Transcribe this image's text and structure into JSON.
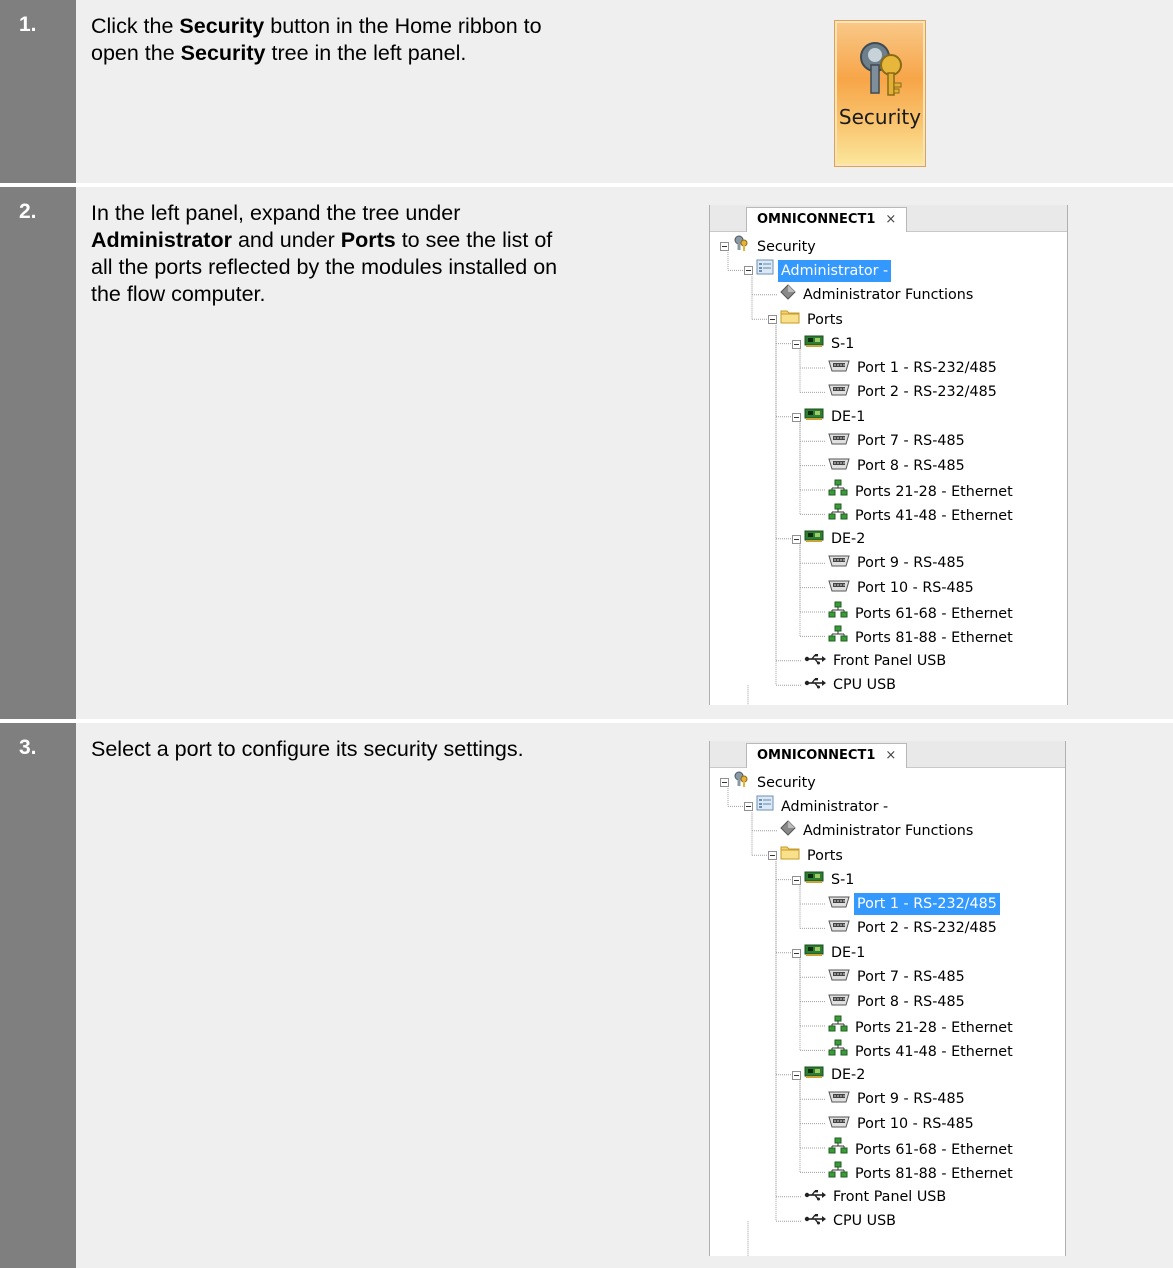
{
  "steps": [
    {
      "number": "1.",
      "text_parts": [
        "Click the ",
        "Security",
        " button in the Home ribbon to open the ",
        "Security",
        " tree in the left panel."
      ],
      "button": {
        "label": "Security",
        "icon": "key-lock-icon"
      }
    },
    {
      "number": "2.",
      "text_parts": [
        "In the left panel, expand the tree under ",
        "Administrator",
        " and under ",
        "Ports",
        " to see the list of all the ports reflected by the modules installed on the flow computer."
      ],
      "panel": {
        "tab_title": "OMNICONNECT1",
        "tab_close": "×",
        "selected": "Administrator -"
      }
    },
    {
      "number": "3.",
      "text_parts": [
        "Select a port to configure its security settings."
      ],
      "panel": {
        "tab_title": "OMNICONNECT1",
        "tab_close": "×",
        "selected": "Port 1 - RS-232/485"
      }
    }
  ],
  "tree": [
    {
      "label": "Security",
      "icon": "security-key-icon"
    },
    {
      "label": "Administrator -",
      "icon": "admin-form-icon"
    },
    {
      "label": "Administrator Functions",
      "icon": "diamond-icon"
    },
    {
      "label": "Ports",
      "icon": "folder-icon"
    },
    {
      "label": "S-1",
      "icon": "module-board-icon"
    },
    {
      "label": "Port 1 - RS-232/485",
      "icon": "serial-port-icon"
    },
    {
      "label": "Port 2 - RS-232/485",
      "icon": "serial-port-icon"
    },
    {
      "label": "DE-1",
      "icon": "module-board-icon"
    },
    {
      "label": "Port 7 - RS-485",
      "icon": "serial-port-icon"
    },
    {
      "label": "Port 8 - RS-485",
      "icon": "serial-port-icon"
    },
    {
      "label": "Ports 21-28 - Ethernet",
      "icon": "ethernet-network-icon"
    },
    {
      "label": "Ports 41-48 - Ethernet",
      "icon": "ethernet-network-icon"
    },
    {
      "label": "DE-2",
      "icon": "module-board-icon"
    },
    {
      "label": "Port 9 - RS-485",
      "icon": "serial-port-icon"
    },
    {
      "label": "Port 10 - RS-485",
      "icon": "serial-port-icon"
    },
    {
      "label": "Ports 61-68 - Ethernet",
      "icon": "ethernet-network-icon"
    },
    {
      "label": "Ports 81-88 - Ethernet",
      "icon": "ethernet-network-icon"
    },
    {
      "label": "Front Panel USB",
      "icon": "usb-icon"
    },
    {
      "label": "CPU USB",
      "icon": "usb-icon"
    }
  ]
}
